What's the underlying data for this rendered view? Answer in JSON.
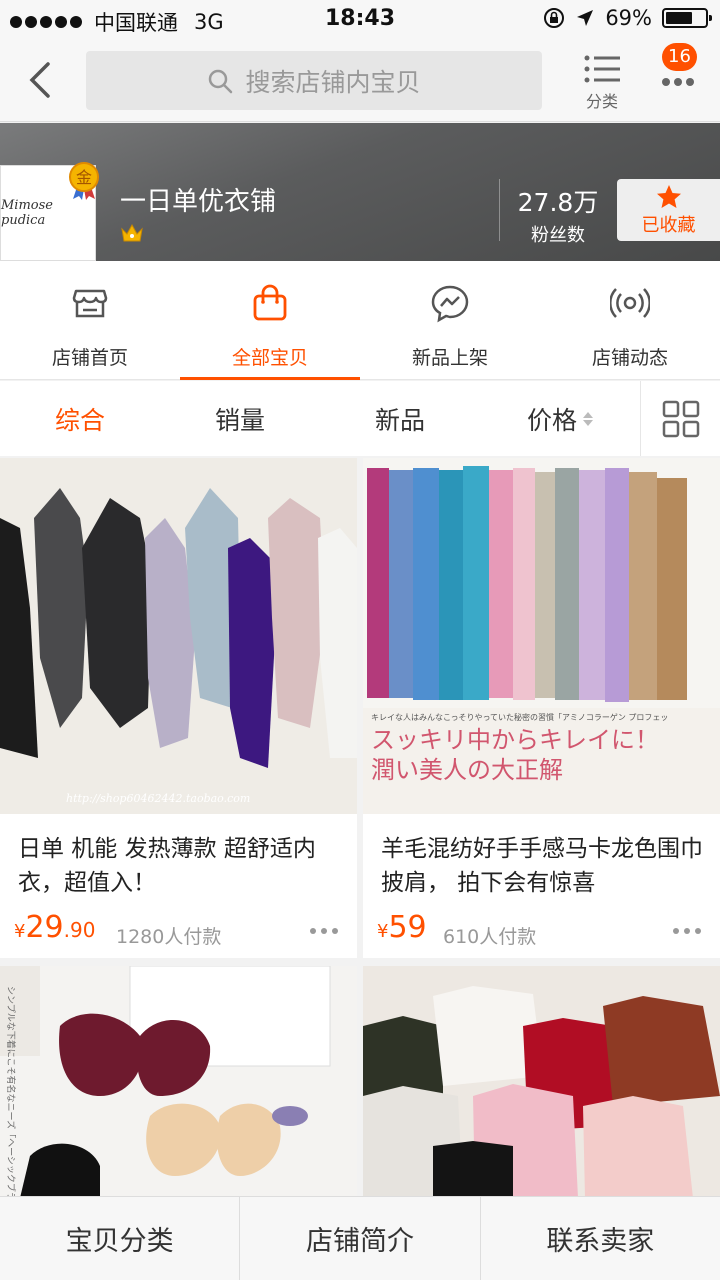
{
  "status_bar": {
    "carrier": "中国联通",
    "network": "3G",
    "time": "18:43",
    "battery": "69%",
    "battery_level": 0.69
  },
  "nav": {
    "search_placeholder": "搜索店铺内宝贝",
    "category_label": "分类",
    "badge_count": "16"
  },
  "shop": {
    "logo_text": "Mimose pudica",
    "gold_badge": "金",
    "name": "一日单优衣铺",
    "fans_count": "27.8万",
    "fans_label": "粉丝数",
    "favorite_label": "已收藏"
  },
  "tabs": [
    {
      "label": "店铺首页",
      "icon": "store-icon",
      "active": false
    },
    {
      "label": "全部宝贝",
      "icon": "bag-icon",
      "active": true
    },
    {
      "label": "新品上架",
      "icon": "new-chat-icon",
      "active": false
    },
    {
      "label": "店铺动态",
      "icon": "broadcast-icon",
      "active": false
    }
  ],
  "sort": {
    "items": [
      "综合",
      "销量",
      "新品",
      "价格"
    ],
    "active_index": 0
  },
  "products": [
    {
      "title": "日单 机能 发热薄款 超舒适内衣，超值入！",
      "currency": "¥",
      "price_main": "29",
      "price_cents": ".90",
      "sold": "1280人付款",
      "watermark": "http://shop60462442.taobao.com"
    },
    {
      "title": "羊毛混纺好手手感马卡龙色围巾披肩， 拍下会有惊喜",
      "currency": "¥",
      "price_main": "59",
      "price_cents": "",
      "sold": "610人付款",
      "overlay_small": "キレイな人はみんなこっそりやっていた秘密の習慣「アミノコラーゲン プロフェッ",
      "overlay_big1": "スッキリ中からキレイに！",
      "overlay_big2": "潤い美人の大正解"
    },
    {
      "title": "",
      "magazine_text": "シンプルな下着にこそ有名なニーズ「ヘーシックブランド」"
    },
    {
      "title": ""
    }
  ],
  "bottom_bar": {
    "items": [
      "宝贝分类",
      "店铺简介",
      "联系卖家"
    ]
  }
}
